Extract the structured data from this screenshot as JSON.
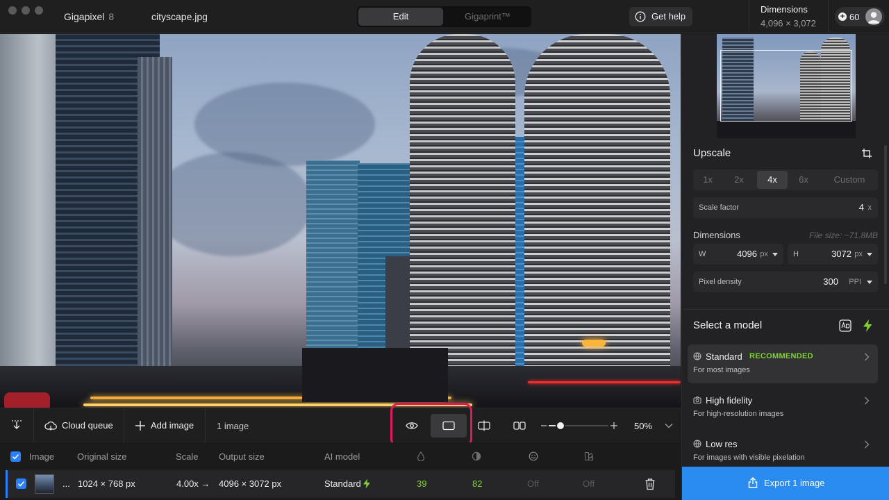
{
  "window": {
    "app_name": "Gigapixel",
    "app_version": "8",
    "file_name": "cityscape.jpg"
  },
  "mode_tabs": [
    {
      "label": "Edit",
      "active": true
    },
    {
      "label": "Gigaprint™",
      "active": false
    }
  ],
  "header": {
    "help_label": "Get help",
    "dimensions_label": "Dimensions",
    "dimensions_value": "4,096 × 3,072",
    "credits": "60"
  },
  "toolbar": {
    "cloud_queue_label": "Cloud queue",
    "add_image_label": "Add image",
    "image_count": "1 image",
    "zoom_label": "50%",
    "zoom_fraction": 0.2
  },
  "table": {
    "headers": {
      "image": "Image",
      "original_size": "Original size",
      "scale": "Scale",
      "output_size": "Output size",
      "ai_model": "AI model"
    },
    "row": {
      "name": "...",
      "original_size": "1024 × 768 px",
      "scale": "4.00x →",
      "output_size": "4096 × 3072 px",
      "ai_model": "Standard",
      "setting_1": "39",
      "setting_2": "82",
      "setting_3": "Off",
      "setting_4": "Off"
    }
  },
  "panel": {
    "upscale_title": "Upscale",
    "scale_options": [
      "1x",
      "2x",
      "4x",
      "6x",
      "Custom"
    ],
    "scale_selected": "4x",
    "scale_factor_label": "Scale factor",
    "scale_factor_value": "4",
    "scale_factor_unit": "x",
    "dimensions_title": "Dimensions",
    "file_size": "File size: ~71.8MB",
    "width_label": "W",
    "width_value": "4096",
    "width_unit": "px",
    "height_label": "H",
    "height_value": "3072",
    "height_unit": "px",
    "density_label": "Pixel density",
    "density_value": "300",
    "density_unit": "PPI",
    "model_title": "Select a model",
    "models": [
      {
        "name": "Standard",
        "badge": "RECOMMENDED",
        "desc": "For most images"
      },
      {
        "name": "High fidelity",
        "badge": "",
        "desc": "For high-resolution images"
      },
      {
        "name": "Low res",
        "badge": "",
        "desc": "For images with visible pixelation"
      }
    ],
    "export_label": "Export 1 image"
  },
  "colors": {
    "accent": "#2a8cf0",
    "recommended": "#7fd12b",
    "highlight": "#e3175f"
  }
}
